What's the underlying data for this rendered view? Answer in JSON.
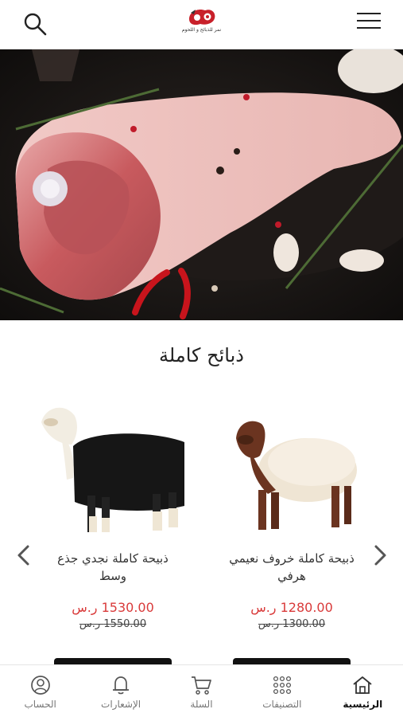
{
  "header": {
    "logo_text": "نمر للذبائح و اللحوم"
  },
  "section": {
    "title": "ذبائح كاملة"
  },
  "products": [
    {
      "name": "ذبيحة كاملة خروف نعيمي هرفي",
      "price": "1280.00 ر.س",
      "old_price": "1300.00 ر.س"
    },
    {
      "name": "ذبيحة كاملة نجدي جذع وسط",
      "price": "1530.00 ر.س",
      "old_price": "1550.00 ر.س"
    }
  ],
  "bottom_nav": [
    {
      "label": "الرئيسية",
      "icon": "home-icon",
      "active": true
    },
    {
      "label": "التصنيفات",
      "icon": "grid-icon",
      "active": false
    },
    {
      "label": "السلة",
      "icon": "cart-icon",
      "active": false
    },
    {
      "label": "الإشعارات",
      "icon": "bell-icon",
      "active": false
    },
    {
      "label": "الحساب",
      "icon": "user-icon",
      "active": false
    }
  ],
  "colors": {
    "price": "#d93a3a",
    "accent": "#c8202a",
    "button": "#111111"
  }
}
